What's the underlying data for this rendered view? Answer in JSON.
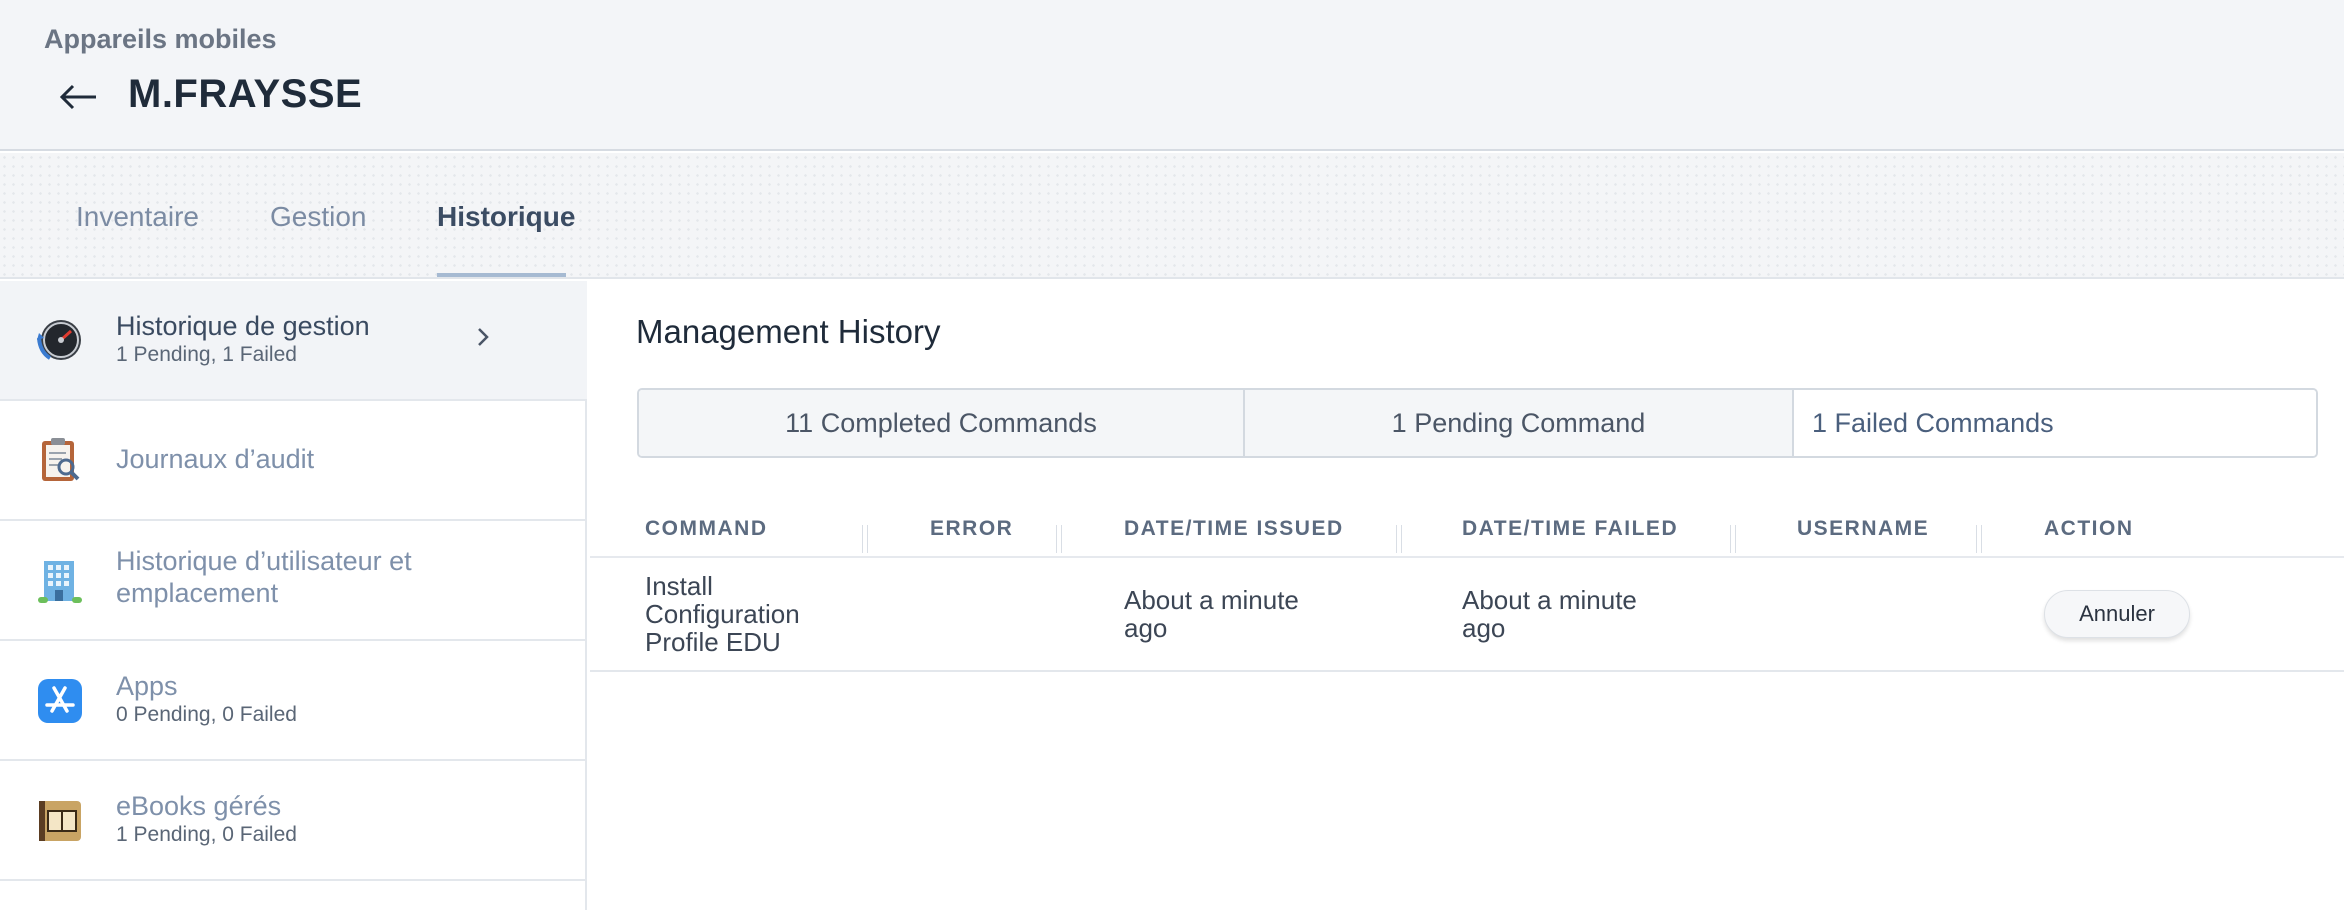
{
  "header": {
    "breadcrumb": "Appareils mobiles",
    "title": "M.FRAYSSE"
  },
  "tabs": [
    {
      "label": "Inventaire",
      "active": false
    },
    {
      "label": "Gestion",
      "active": false
    },
    {
      "label": "Historique",
      "active": true
    }
  ],
  "sidebar": {
    "items": [
      {
        "title": "Historique de gestion",
        "subtitle": "1 Pending, 1 Failed",
        "icon": "gauge-icon",
        "active": true
      },
      {
        "title": "Journaux d’audit",
        "subtitle": "",
        "icon": "clipboard-magnifier-icon",
        "active": false
      },
      {
        "title": "Historique d’utilisateur et emplacement",
        "subtitle": "",
        "icon": "building-icon",
        "active": false
      },
      {
        "title": "Apps",
        "subtitle": "0 Pending, 0 Failed",
        "icon": "app-store-icon",
        "active": false
      },
      {
        "title": "eBooks gérés",
        "subtitle": "1 Pending, 0 Failed",
        "icon": "book-icon",
        "active": false
      }
    ]
  },
  "main": {
    "title": "Management History",
    "segments": [
      {
        "label": "11 Completed Commands",
        "active": false
      },
      {
        "label": "1 Pending Command",
        "active": false
      },
      {
        "label": "1 Failed Commands",
        "active": true
      }
    ],
    "columns": [
      "COMMAND",
      "ERROR",
      "DATE/TIME ISSUED",
      "DATE/TIME FAILED",
      "USERNAME",
      "ACTION"
    ],
    "rows": [
      {
        "command": "Install Configuration Profile EDU",
        "error": "",
        "issued": "About a minute ago",
        "failed": "About a minute ago",
        "username": "",
        "action": "Annuler"
      }
    ]
  },
  "colors": {
    "header_bg": "#f3f5f8",
    "tab_underline": "#a6bad2",
    "link_blue": "#7e90aa",
    "text_dark": "#1f2b3a"
  }
}
